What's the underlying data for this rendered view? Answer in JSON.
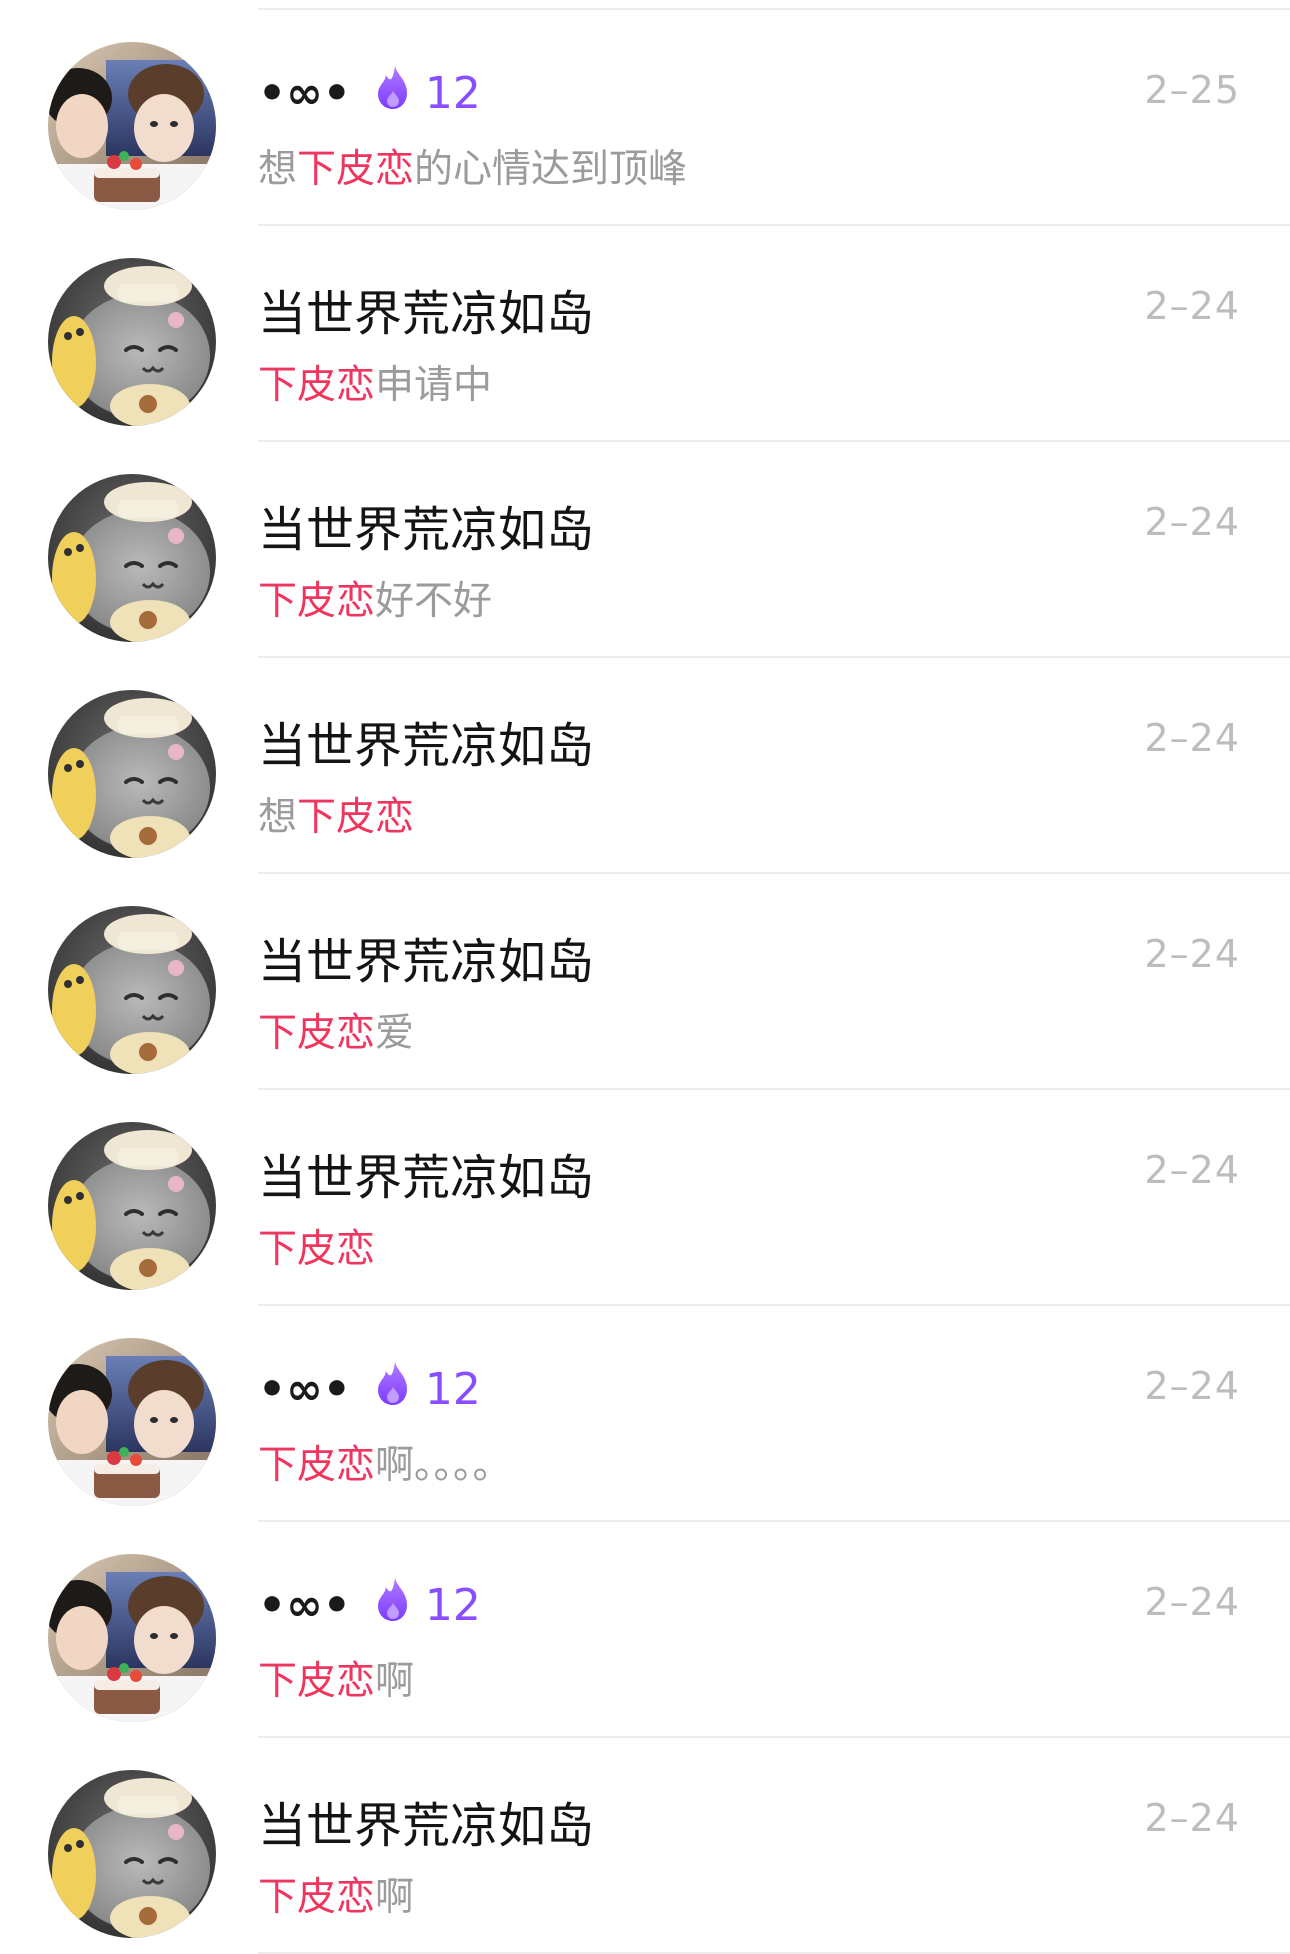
{
  "conversations": [
    {
      "name": "•∞•",
      "is_special": true,
      "fire_count": "12",
      "time": "2–25",
      "avatar": "couple-photo",
      "msg": [
        {
          "text": "想",
          "hl": false
        },
        {
          "text": "下皮恋",
          "hl": true
        },
        {
          "text": "的心情达到顶峰",
          "hl": false
        }
      ]
    },
    {
      "name": "当世界荒凉如岛",
      "is_special": false,
      "fire_count": "",
      "time": "2–24",
      "avatar": "plush-cat",
      "msg": [
        {
          "text": "下皮恋",
          "hl": true
        },
        {
          "text": "申请中",
          "hl": false
        }
      ]
    },
    {
      "name": "当世界荒凉如岛",
      "is_special": false,
      "fire_count": "",
      "time": "2–24",
      "avatar": "plush-cat",
      "msg": [
        {
          "text": "下皮恋",
          "hl": true
        },
        {
          "text": "好不好",
          "hl": false
        }
      ]
    },
    {
      "name": "当世界荒凉如岛",
      "is_special": false,
      "fire_count": "",
      "time": "2–24",
      "avatar": "plush-cat",
      "msg": [
        {
          "text": "想",
          "hl": false
        },
        {
          "text": "下皮恋",
          "hl": true
        }
      ]
    },
    {
      "name": "当世界荒凉如岛",
      "is_special": false,
      "fire_count": "",
      "time": "2–24",
      "avatar": "plush-cat",
      "msg": [
        {
          "text": "下皮恋",
          "hl": true
        },
        {
          "text": "爱",
          "hl": false
        }
      ]
    },
    {
      "name": "当世界荒凉如岛",
      "is_special": false,
      "fire_count": "",
      "time": "2–24",
      "avatar": "plush-cat",
      "msg": [
        {
          "text": "下皮恋",
          "hl": true
        }
      ]
    },
    {
      "name": "•∞•",
      "is_special": true,
      "fire_count": "12",
      "time": "2–24",
      "avatar": "couple-photo",
      "msg": [
        {
          "text": "下皮恋",
          "hl": true
        },
        {
          "text": "啊。。。。",
          "hl": false
        }
      ]
    },
    {
      "name": "•∞•",
      "is_special": true,
      "fire_count": "12",
      "time": "2–24",
      "avatar": "couple-photo",
      "msg": [
        {
          "text": "下皮恋",
          "hl": true
        },
        {
          "text": "啊",
          "hl": false
        }
      ]
    },
    {
      "name": "当世界荒凉如岛",
      "is_special": false,
      "fire_count": "",
      "time": "2–24",
      "avatar": "plush-cat",
      "msg": [
        {
          "text": "下皮恋",
          "hl": true
        },
        {
          "text": "啊",
          "hl": false
        }
      ]
    }
  ],
  "colors": {
    "highlight": "#f0355f",
    "fire": "#8a4dff",
    "name": "#141414",
    "message": "#9b9b9b",
    "time": "#bdbdbd",
    "divider": "#ececec"
  },
  "icons": {
    "fire": "fire-icon"
  }
}
